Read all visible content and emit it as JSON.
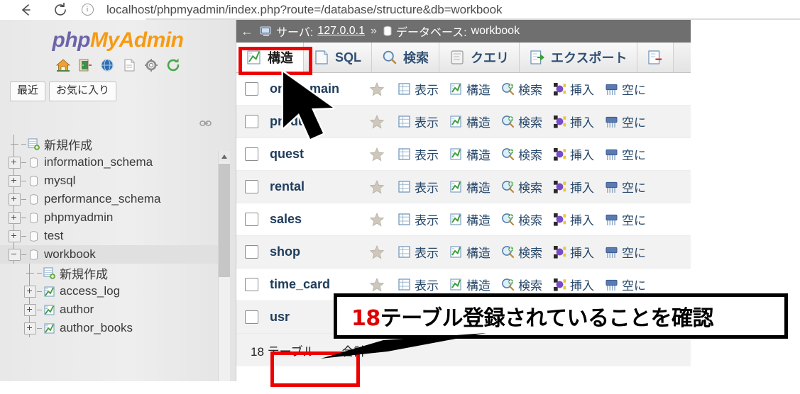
{
  "browser": {
    "back_icon": "back-arrow-icon",
    "reload_icon": "reload-icon",
    "info_icon": "info-circle-icon",
    "url": "localhost/phpmyadmin/index.php?route=/database/structure&db=workbook"
  },
  "sidebar": {
    "logo": {
      "php": "php",
      "my": "My",
      "admin": "Admin"
    },
    "icons": [
      "home-icon",
      "logout-icon",
      "help-globe-icon",
      "sql-doc-icon",
      "settings-gear-icon",
      "reload-circle-icon"
    ],
    "quick_tabs": [
      {
        "label": "最近",
        "name": "recent-tab"
      },
      {
        "label": "お気に入り",
        "name": "favorites-tab"
      }
    ],
    "link_icon": "chain-link-icon",
    "tree": [
      {
        "label": "新規作成",
        "type": "new",
        "indent": 0,
        "expander": "none",
        "style": "plain"
      },
      {
        "label": "information_schema",
        "type": "db",
        "indent": 0,
        "expander": "plus",
        "style": "plain"
      },
      {
        "label": "mysql",
        "type": "db",
        "indent": 0,
        "expander": "plus",
        "style": "plain"
      },
      {
        "label": "performance_schema",
        "type": "db",
        "indent": 0,
        "expander": "plus",
        "style": "plain"
      },
      {
        "label": "phpmyadmin",
        "type": "db",
        "indent": 0,
        "expander": "plus",
        "style": "plain"
      },
      {
        "label": "test",
        "type": "db",
        "indent": 0,
        "expander": "plus",
        "style": "plain"
      },
      {
        "label": "workbook",
        "type": "db",
        "indent": 0,
        "expander": "minus",
        "style": "plain",
        "selected": true
      },
      {
        "label": "新規作成",
        "type": "new-table",
        "indent": 1,
        "expander": "none",
        "style": "plain"
      },
      {
        "label": "access_log",
        "type": "table",
        "indent": 1,
        "expander": "plus",
        "style": "plain"
      },
      {
        "label": "author",
        "type": "table",
        "indent": 1,
        "expander": "plus",
        "style": "plain"
      },
      {
        "label": "author_books",
        "type": "table",
        "indent": 1,
        "expander": "plus",
        "style": "plain"
      }
    ]
  },
  "main": {
    "breadcrumb": {
      "back": "←",
      "server_icon": "server-icon",
      "server_label": "サーバ:",
      "server_value": "127.0.0.1",
      "separator": "»",
      "db_icon": "database-icon",
      "db_label": "データベース:",
      "db_value": "workbook"
    },
    "tabs": [
      {
        "label": "構造",
        "icon": "structure-icon",
        "active": true
      },
      {
        "label": "SQL",
        "icon": "sql-icon",
        "active": false
      },
      {
        "label": "検索",
        "icon": "search-magnifier-icon",
        "active": false
      },
      {
        "label": "クエリ",
        "icon": "query-icon",
        "active": false
      },
      {
        "label": "エクスポート",
        "icon": "export-icon",
        "active": false
      },
      {
        "label": "",
        "icon": "import-icon",
        "active": false
      }
    ],
    "row_actions": [
      {
        "label": "表示",
        "icon": "browse-icon"
      },
      {
        "label": "構造",
        "icon": "structure-icon"
      },
      {
        "label": "検索",
        "icon": "search-icon"
      },
      {
        "label": "挿入",
        "icon": "insert-icon"
      },
      {
        "label": "空に",
        "icon": "empty-icon"
      }
    ],
    "tables": [
      {
        "name": "order_main",
        "display": "ord    ain"
      },
      {
        "name": "product",
        "display": "pro     "
      },
      {
        "name": "quest",
        "display": "quest"
      },
      {
        "name": "rental",
        "display": "rental"
      },
      {
        "name": "sales",
        "display": "sales"
      },
      {
        "name": "shop",
        "display": "shop"
      },
      {
        "name": "time_card",
        "display": "time_ca"
      },
      {
        "name": "usr",
        "display": "usr"
      }
    ],
    "footer": {
      "count": "18 テーブル",
      "total": "合計"
    }
  },
  "annotations": {
    "callout_number": "18",
    "callout_text": "テーブル登録されていることを確認",
    "highlight_color": "#ee0000",
    "callout_border_color": "#000000"
  }
}
